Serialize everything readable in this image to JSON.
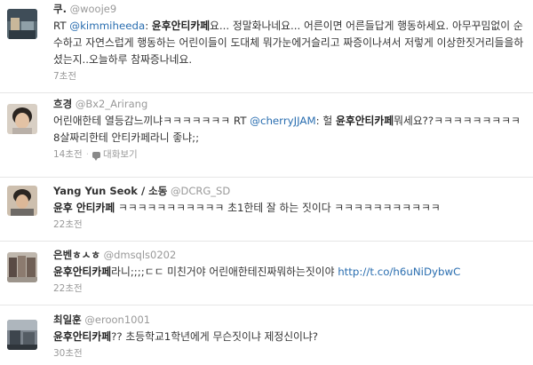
{
  "tweets": [
    {
      "name": "쿠.",
      "handle": "@wooje9",
      "body": {
        "prefix": "RT ",
        "mention": "@kimmiheeda",
        "sep": ": ",
        "hl": "윤후안티카페",
        "rest": "요... 정말화나네요... 어른이면 어른들답게 행동하세요. 아무꾸밈없이 순수하고 자연스럽게 행동하는 어린이들이 도대체 뭐가눈에거슬리고 짜증이나셔서 저렇게 이상한짓거리들을하셨는지..오늘하루 참짜증나네요."
      },
      "time": "7초전"
    },
    {
      "name": "흐경",
      "handle": "@Bx2_Arirang",
      "body": {
        "prefix": "어린애한테 열등감느끼냐ㅋㅋㅋㅋㅋㅋㅋ RT ",
        "mention": "@cherryJJAM",
        "sep": ": 헐 ",
        "hl": "윤후안티카페",
        "rest": "뭐세요??ㅋㅋㅋㅋㅋㅋㅋㅋㅋ8살짜리한테 안티카페라니 좋냐;;"
      },
      "time": "14초전",
      "conversation": "대화보기"
    },
    {
      "name": "Yang Yun Seok / 소동",
      "handle": "@DCRG_SD",
      "body": {
        "hl": "윤후 안티카페",
        "rest": " ㅋㅋㅋㅋㅋㅋㅋㅋㅋㅋㅋ 초1한테 잘 하는 짓이다 ㅋㅋㅋㅋㅋㅋㅋㅋㅋㅋㅋ"
      },
      "time": "22초전"
    },
    {
      "name": "은벤ㅎㅅㅎ",
      "handle": "@dmsqls0202",
      "body": {
        "hl": "윤후안티카페",
        "rest": "라니;;;;ㄷㄷ 미친거야 어린애한테진짜뭐하는짓이야 ",
        "link": "http://t.co/h6uNiDybwC"
      },
      "time": "22초전"
    },
    {
      "name": "최일훈",
      "handle": "@eroon1001",
      "body": {
        "hl": "윤후안티카페",
        "rest": "?? 초등학교1학년에게 무슨짓이냐 제정신이냐?"
      },
      "time": "30초전"
    }
  ]
}
